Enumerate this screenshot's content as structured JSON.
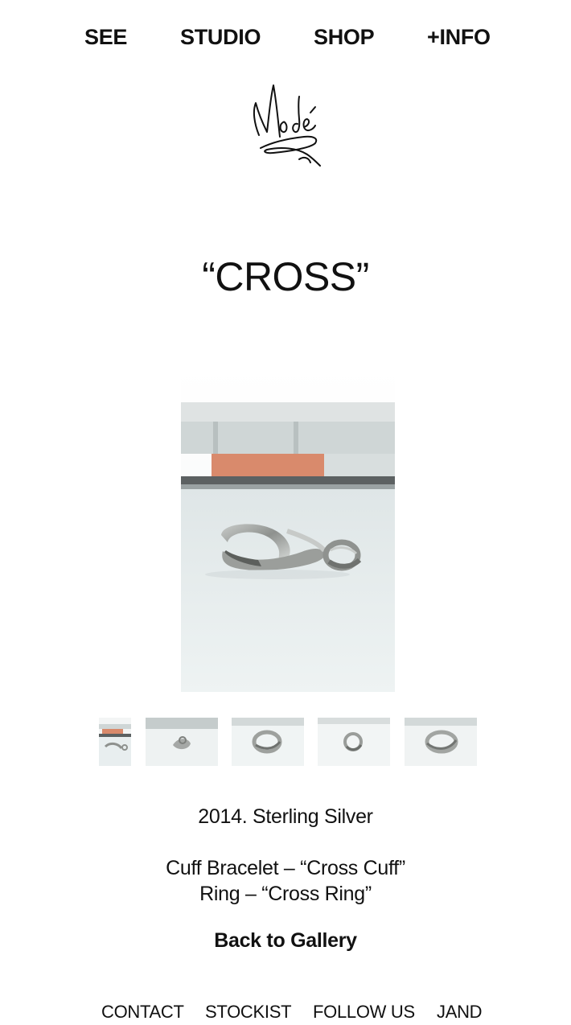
{
  "nav": {
    "see": "SEE",
    "studio": "STUDIO",
    "shop": "SHOP",
    "info": "+INFO"
  },
  "logo": {
    "text": "Modé"
  },
  "product": {
    "title": "“CROSS”",
    "year_material": "2014. Sterling Silver",
    "item_cuff": "Cuff Bracelet – “Cross Cuff”",
    "item_ring": "Ring – “Cross Ring”"
  },
  "gallery": {
    "back_label": "Back to Gallery",
    "thumbnail_count": 5
  },
  "footer": {
    "contact": "CONTACT",
    "stockist": "STOCKIST",
    "follow": "FOLLOW US",
    "jand": "JAND"
  },
  "colors": {
    "text": "#111111",
    "background": "#ffffff",
    "window_orange": "#d98a6c",
    "sill": "#e9eff0"
  }
}
